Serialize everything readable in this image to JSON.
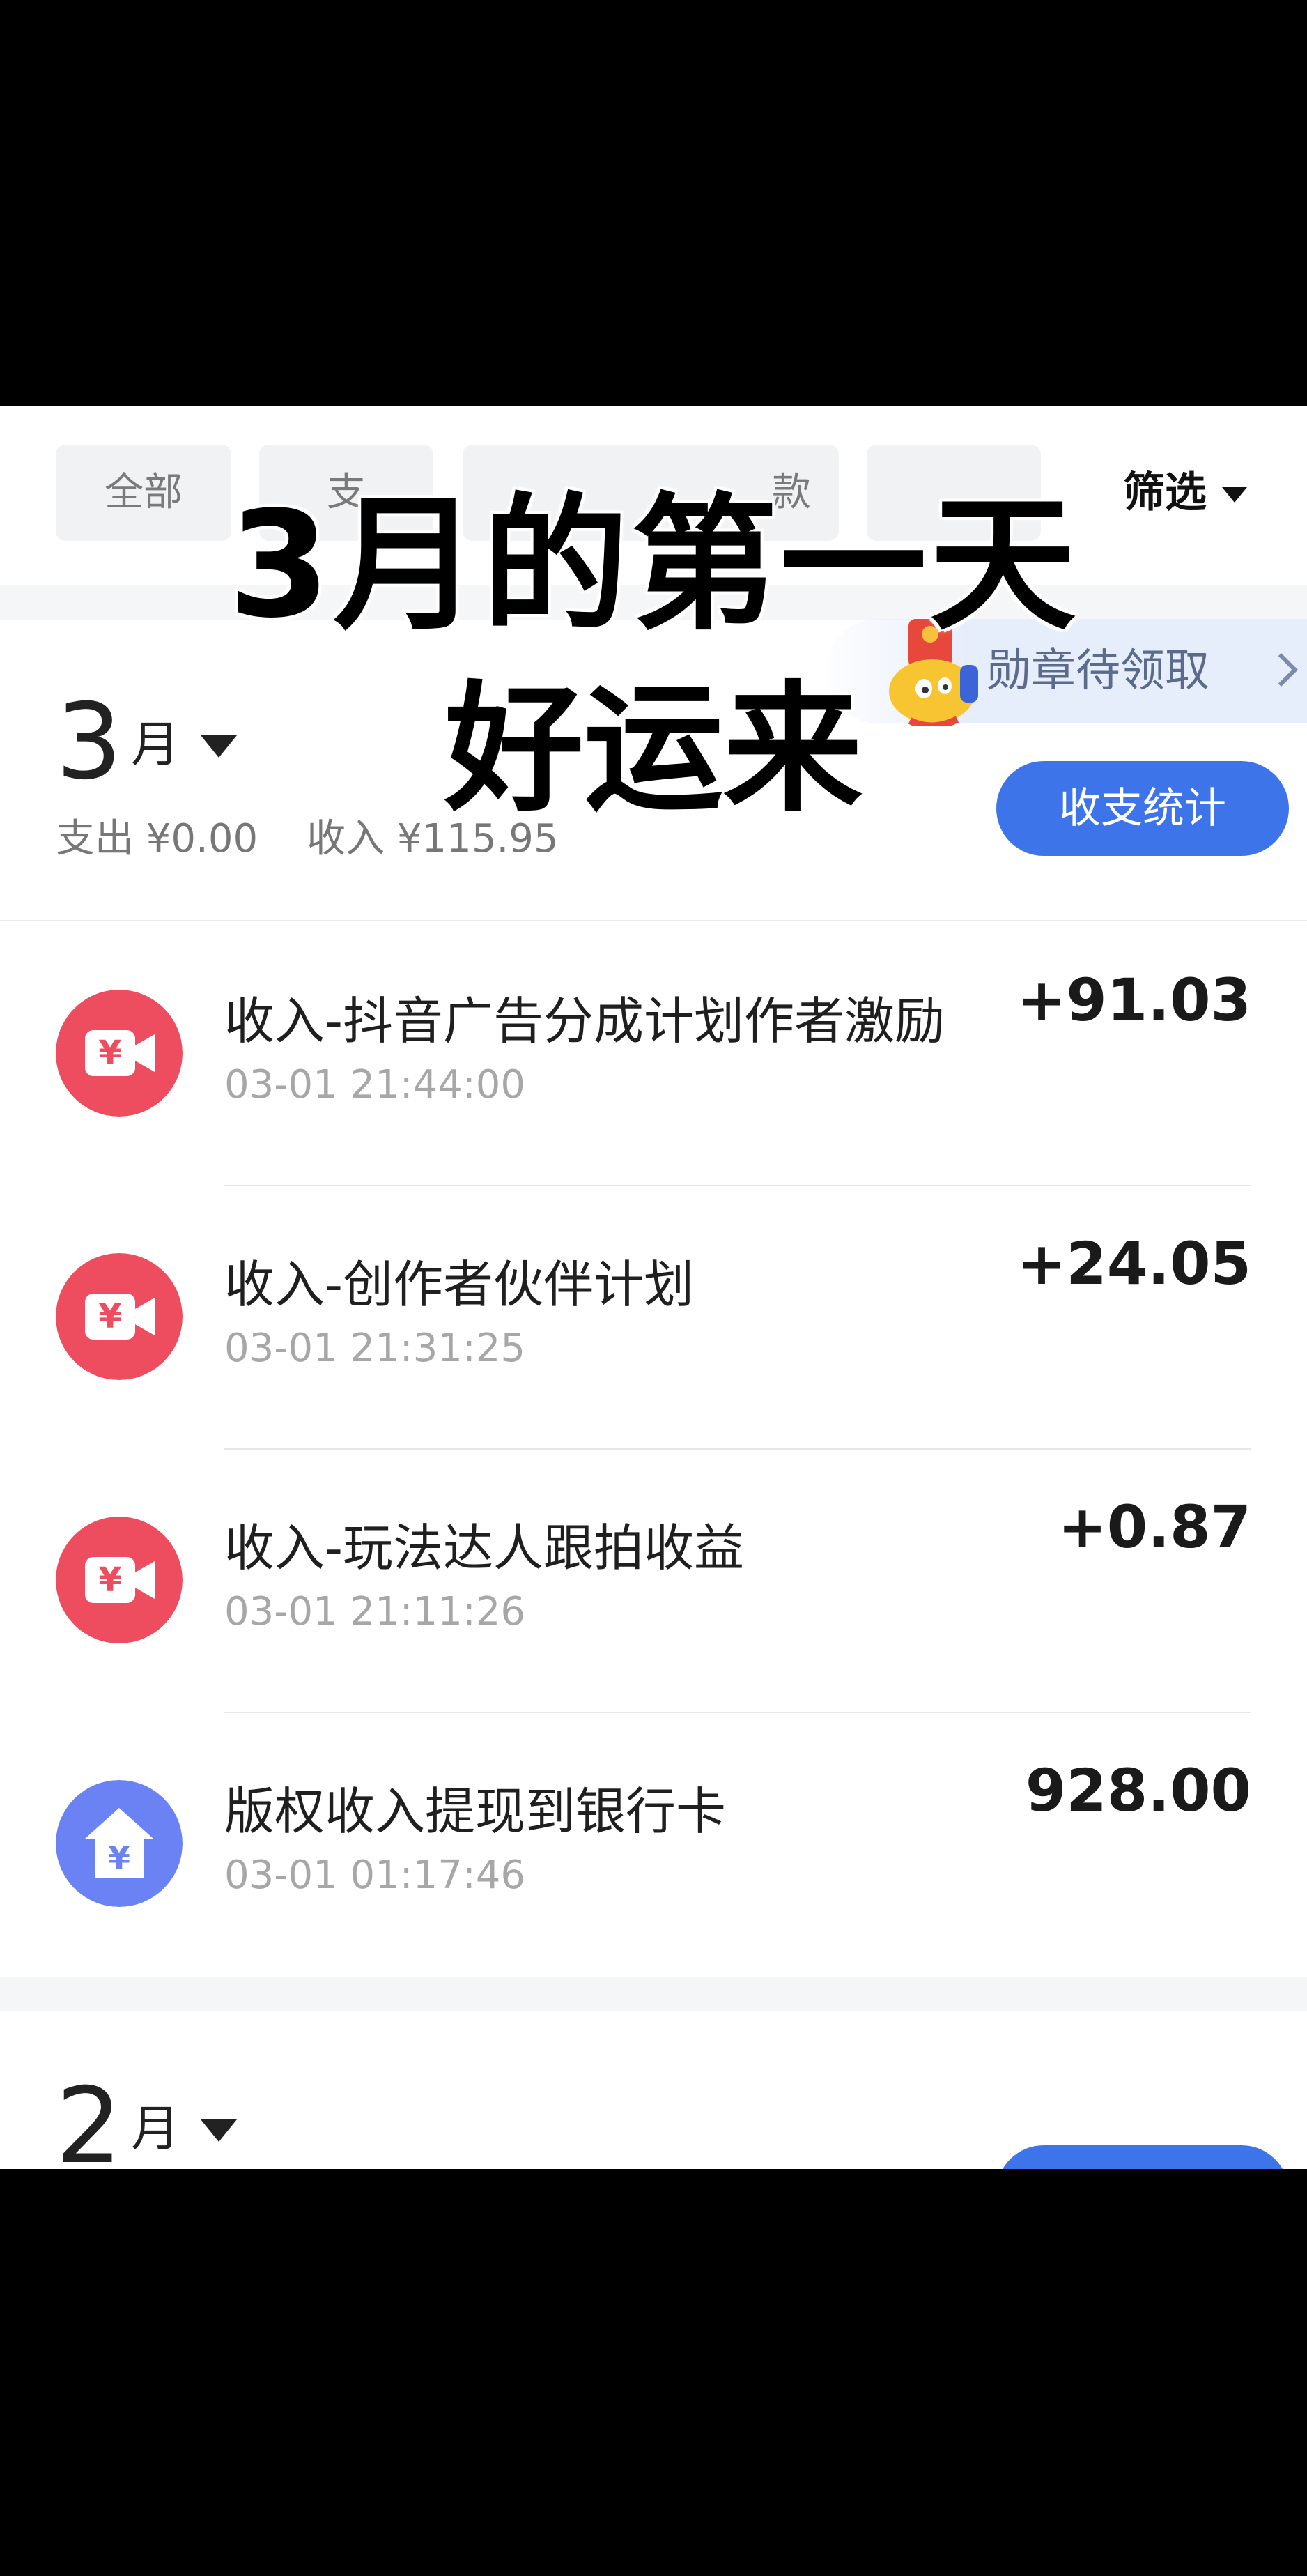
{
  "filter_tabs": [
    "全部",
    "支",
    "款",
    "",
    ""
  ],
  "filter_label": "筛选",
  "badge_banner": "勋章待领取",
  "overlay": {
    "line1": "3月的第一天",
    "line2": "好运来"
  },
  "months": [
    {
      "number": "3",
      "unit": "月",
      "expense": "支出 ¥0.00",
      "income": "收入 ¥115.95",
      "stat_button": "收支统计"
    },
    {
      "number": "2",
      "unit": "月"
    }
  ],
  "transactions": [
    {
      "title": "收入-抖音广告分成计划作者激励",
      "time": "03-01 21:44:00",
      "amount": "+91.03",
      "icon": "yuan-video-icon",
      "color": "#ee4d5f"
    },
    {
      "title": "收入-创作者伙伴计划",
      "time": "03-01 21:31:25",
      "amount": "+24.05",
      "icon": "yuan-video-icon",
      "color": "#ee4d5f"
    },
    {
      "title": "收入-玩法达人跟拍收益",
      "time": "03-01 21:11:26",
      "amount": "+0.87",
      "icon": "yuan-video-icon",
      "color": "#ee4d5f"
    },
    {
      "title": "版权收入提现到银行卡",
      "time": "03-01 01:17:46",
      "amount": "928.00",
      "icon": "yuan-house-icon",
      "color": "#6a82f4"
    }
  ],
  "colors": {
    "accent_blue": "#3e74ea",
    "income_red": "#ee4d5f",
    "withdraw_blue": "#6a82f4"
  }
}
